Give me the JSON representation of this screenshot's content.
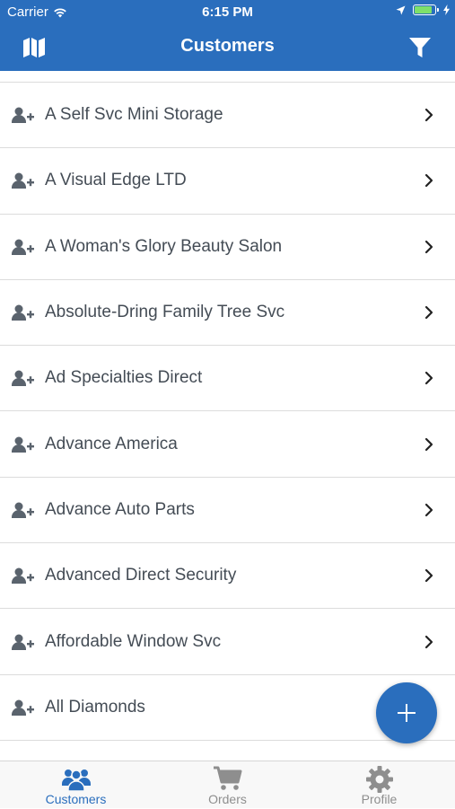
{
  "status_bar": {
    "carrier": "Carrier",
    "time": "6:15 PM"
  },
  "nav": {
    "title": "Customers",
    "left_icon": "map-icon",
    "right_icon": "filter-icon"
  },
  "customers": [
    "A Self Svc Mini Storage",
    "A Visual Edge LTD",
    "A Woman's Glory Beauty Salon",
    "Absolute-Dring Family Tree Svc",
    "Ad Specialties Direct",
    "Advance America",
    "Advance Auto Parts",
    "Advanced Direct Security",
    "Affordable Window Svc",
    "All Diamonds"
  ],
  "fab": {
    "icon": "plus-icon"
  },
  "tabs": [
    {
      "label": "Customers",
      "icon": "customers-icon",
      "active": true
    },
    {
      "label": "Orders",
      "icon": "cart-icon",
      "active": false
    },
    {
      "label": "Profile",
      "icon": "gear-icon",
      "active": false
    }
  ],
  "colors": {
    "primary": "#2a6ebd",
    "text": "#444c55",
    "inactive": "#8e8e8e",
    "divider": "#dcdcdc"
  }
}
